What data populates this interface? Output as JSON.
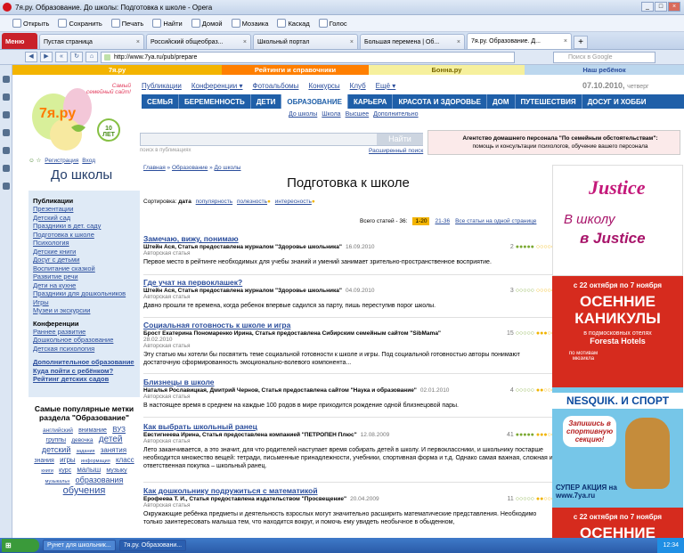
{
  "browser": {
    "title": "7я.ру. Образование. До школы: Подготовка к школе - Opera",
    "toolbar": [
      "Открыть",
      "Сохранить",
      "Печать",
      "Найти",
      "Домой",
      "Мозаика",
      "Каскад",
      "Голос"
    ],
    "menu_label": "Меню",
    "tabs": [
      {
        "label": "Пустая страница"
      },
      {
        "label": "Российский общеобраз..."
      },
      {
        "label": "Школьный портал"
      },
      {
        "label": "Большая перемена | Об..."
      },
      {
        "label": "7я.ру. Образование. Д..."
      }
    ],
    "url": "http://www.7ya.ru/pub/prepare",
    "search_placeholder": "Поиск в Google",
    "status_text": "Загрузка данных с img.files.7ya.ru",
    "zoom": "Вид (100%)"
  },
  "site": {
    "bar": [
      "7я.ру",
      "Рейтинги и справочники",
      "Бонна.ру",
      "Наш ребёнок"
    ],
    "logo_tagline": "Самый семейный сайт!",
    "logo_name": "7я.ру",
    "logo_badge": "10 ЛЕТ",
    "nav_top": [
      "Публикации",
      "Конференции ▾",
      "Фотоальбомы",
      "Конкурсы",
      "Клуб",
      "Ещё ▾"
    ],
    "date": "07.10.2010,",
    "weekday": "четверг",
    "nav_main": [
      "СЕМЬЯ",
      "БЕРЕМЕННОСТЬ",
      "ДЕТИ",
      "ОБРАЗОВАНИЕ",
      "КАРЬЕРА",
      "КРАСОТА И ЗДОРОВЬЕ",
      "ДОМ",
      "ПУТЕШЕСТВИЯ",
      "ДОСУГ И ХОББИ"
    ],
    "nav_sub": [
      "До школы",
      "Школа",
      "Высшее",
      "Дополнительно"
    ],
    "search_hint": "поиск в публикациях",
    "search_btn": "Найти",
    "adv_search": "Расширенный поиск",
    "agency_title": "Агентство домашнего персонала \"По семейным обстоятельствам\":",
    "agency_text": "помощь и консультации психологов, обучение вашего персонала",
    "reg_link": "Регистрация",
    "login_link": "Вход",
    "section_title": "До школы"
  },
  "leftmenu": {
    "pub_head": "Публикации",
    "pub_items": [
      "Презентации",
      "Детский сад",
      "Праздники в дет. саду",
      "Подготовка к школе",
      "Психология",
      "Детские книги",
      "Досуг с детьми",
      "Воспитание сказкой",
      "Развитие речи",
      "Дети на кухне",
      "Праздники для дошкольников",
      "Игры",
      "Музеи и экскурсии"
    ],
    "conf_head": "Конференции",
    "conf_items": [
      "Раннее развитие",
      "Дошкольное образование",
      "Детская психология"
    ],
    "extra_items": [
      "Дополнительное образование",
      "Куда пойти с ребёнком?",
      "Рейтинг детских садов"
    ]
  },
  "popular": {
    "title": "Самые популярные метки раздела \"Образование\"",
    "tags": [
      "английский",
      "внимание",
      "ВУЗ",
      "группы",
      "девочка",
      "детей",
      "детский",
      "задания",
      "занятия",
      "знания",
      "игры",
      "информация",
      "класс",
      "книги",
      "курс",
      "малыш",
      "музыку",
      "музыкальн",
      "образования",
      "обучения"
    ]
  },
  "main": {
    "breadcrumb": [
      "Главная",
      "Образование",
      "До школы"
    ],
    "title": "Подготовка к школе",
    "sort_label": "Сортировка:",
    "sort_opts": [
      "дата",
      "популярность",
      "полезность",
      "интересность"
    ],
    "total": "Всего статей - 36:",
    "pages": [
      "1-20",
      "21-36",
      "Все статьи на одной странице"
    ],
    "articles": [
      {
        "title": "Замечаю, вижу, понимаю",
        "author": "Штейн Ася, Статья предоставлена журналом \"Здоровье школьника\"",
        "date": "16.09.2010",
        "kind": "Авторская статья",
        "rating": "2",
        "snippet": "Первое место в рейтинге необходимых для учебы знаний и умений занимает зрительно-пространственное восприятие."
      },
      {
        "title": "Где учат на первоклашек?",
        "author": "Штейн Ася, Статья предоставлена журналом \"Здоровье школьника\"",
        "date": "04.09.2010",
        "kind": "Авторская статья",
        "rating": "3",
        "snippet": "Давно прошли те времена, когда ребенок впервые садился за парту, пишь переступив порог школы."
      },
      {
        "title": "Социальная готовность к школе и игра",
        "author": "Брост Екатерина Пономаренко Ирина, Статья предоставлена Сибирским семейным сайтом \"SibMama\"",
        "date": "28.02.2010",
        "kind": "Авторская статья",
        "rating": "15",
        "snippet": "Эту статью мы хотели бы посвятить теме социальной готовности к школе и игры. Под социальной готовностью авторы понимают достаточную сформированность эмоционально-волевого компонента..."
      },
      {
        "title": "Близнецы в школе",
        "author": "Наталья Рославицкая, Дмитрий Чернов, Статья предоставлена сайтом \"Наука и образование\"",
        "date": "02.01.2010",
        "kind": "Авторская статья",
        "rating": "4",
        "snippet": "В настоящее время в среднем на каждые 100 родов в мире приходится рождение одной близнецовой пары."
      },
      {
        "title": "Как выбрать школьный ранец",
        "author": "Евстигнеева Ирина, Статья предоставлена компанией \"ПЕТРОПЕН Плюс\"",
        "date": "12.08.2009",
        "kind": "Авторская статья",
        "rating": "41",
        "snippet": "Лето заканчивается, а это значит, для что родителей наступает время собирать детей в школу. И первоклассники, и школьнику постарше необходится множество вещей: тетради, письменные принадлежности, учебники, спортивная форма и т.д. Однако самая важная, сложная и ответственная покупка – школьный ранец."
      },
      {
        "title": "Как дошкольнику подружиться с математикой",
        "author": "Ерофеева Т. И., Статья предоставлена издательством \"Просвещение\"",
        "date": "20.04.2009",
        "kind": "Авторская статья",
        "rating": "11",
        "snippet": "Окружающие ребёнка предметы и деятельность взрослых могут значительно расширить математические представления. Необходимо только заинтересовать малыша тем, что находится вокруг, и помочь ему увидеть необычное в обыденном,"
      }
    ]
  },
  "banners": {
    "b1_logo": "Justice",
    "b1_line1": "В школу",
    "b1_line2": "в Justice",
    "b2_top": "с 22 октября по 7 ноября",
    "b2_big": "ОСЕННИЕ КАНИКУЛЫ",
    "b2_sub": "в подмосковных отелях",
    "b2_hotel": "Foresta Hotels",
    "b2_foot": "по мотивам мюзикла",
    "b3_title": "NESQUIK. И СПОРТ",
    "b3_bubble": "Запишись в спортивную секцию!",
    "b3_foot": "СУПЕР АКЦИЯ на www.7ya.ru",
    "b4_top": "с 22 октября по 7 ноября",
    "b4_big": "ОСЕННИЕ"
  },
  "taskbar": {
    "tasks": [
      "Рунет для школьник...",
      "7я.ру. Образовани..."
    ],
    "clock": "12:34"
  }
}
